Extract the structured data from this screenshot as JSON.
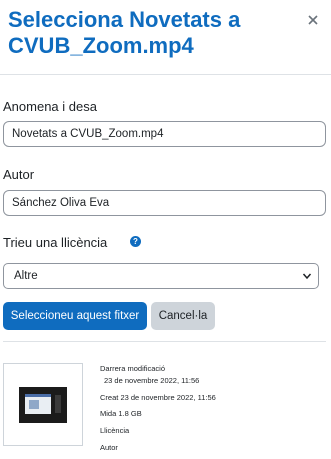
{
  "header": {
    "title": "Selecciona Novetats a\nCVUB_Zoom.mp4",
    "close_icon": "close-icon"
  },
  "form": {
    "save_as_label": "Anomena i desa",
    "save_as_value": "Novetats a CVUB_Zoom.mp4",
    "author_label": "Autor",
    "author_value": "Sánchez Oliva Eva",
    "license_label": "Trieu una llicència",
    "license_help_icon": "question-circle-icon",
    "license_value": "Altre"
  },
  "buttons": {
    "select_label": "Seleccioneu aquest fitxer",
    "cancel_label": "Cancel·la"
  },
  "file_info": {
    "last_modified_label": "Darrera modificació",
    "last_modified_value": "23 de novembre 2022, 11:56",
    "created_label": "Creat",
    "created_value": "23 de novembre 2022, 11:56",
    "size_label": "Mida",
    "size_value": "1.8 GB",
    "license_label": "Llicència",
    "author_label": "Autor"
  },
  "colors": {
    "accent": "#0f6cbf",
    "secondary_button": "#ced4da"
  }
}
